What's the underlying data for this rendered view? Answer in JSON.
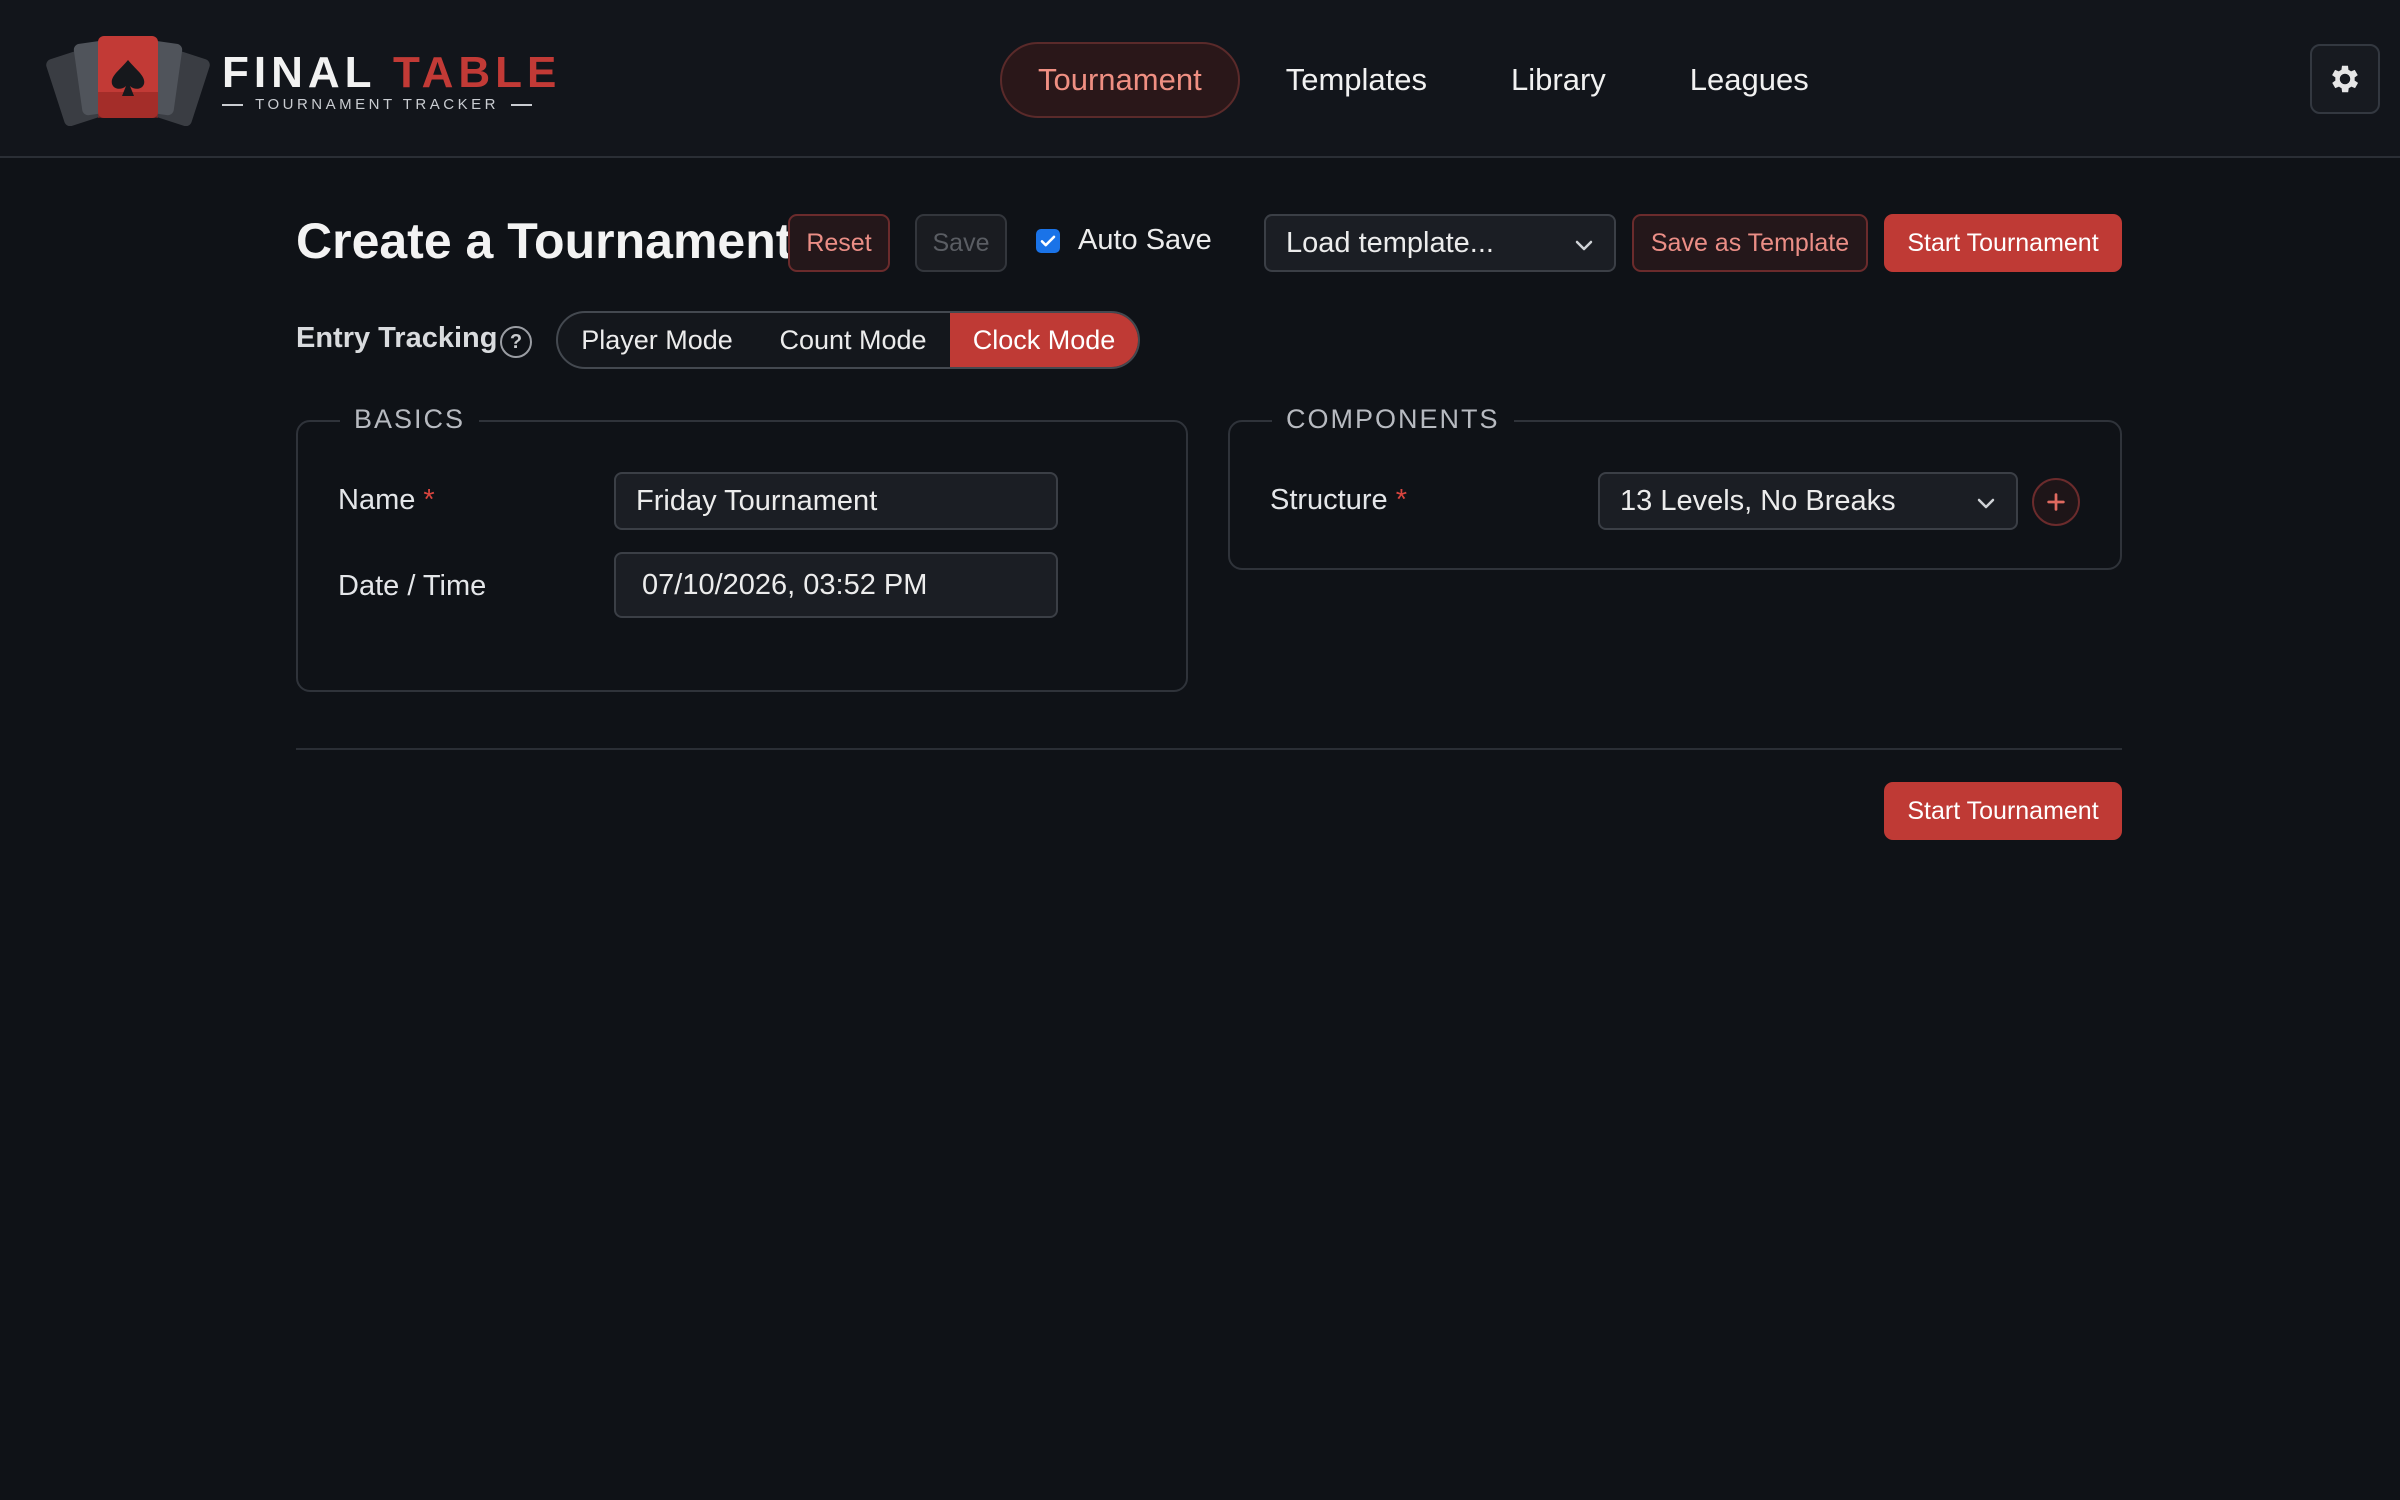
{
  "brand": {
    "title_main": "FINAL",
    "title_accent": "TABLE",
    "subtitle": "TOURNAMENT TRACKER"
  },
  "nav": {
    "items": [
      {
        "label": "Tournament",
        "active": true
      },
      {
        "label": "Templates",
        "active": false
      },
      {
        "label": "Library",
        "active": false
      },
      {
        "label": "Leagues",
        "active": false
      }
    ]
  },
  "toolbar": {
    "title": "Create a Tournament",
    "reset_label": "Reset",
    "save_label": "Save",
    "autosave_label": "Auto Save",
    "autosave_checked": true,
    "load_template_value": "Load template...",
    "save_template_label": "Save as Template",
    "start_label": "Start Tournament"
  },
  "entry_tracking": {
    "label": "Entry Tracking",
    "help": "?",
    "modes": [
      {
        "label": "Player Mode",
        "active": false
      },
      {
        "label": "Count Mode",
        "active": false
      },
      {
        "label": "Clock Mode",
        "active": true
      }
    ]
  },
  "basics": {
    "legend": "BASICS",
    "name_label": "Name",
    "name_value": "Friday Tournament",
    "datetime_label": "Date / Time",
    "datetime_value": "07/10/2026, 03:52 PM",
    "required_mark": "*"
  },
  "components": {
    "legend": "COMPONENTS",
    "structure_label": "Structure",
    "structure_value": "13 Levels, No Breaks",
    "required_mark": "*"
  },
  "footer": {
    "start_label": "Start Tournament"
  },
  "colors": {
    "accent": "#bf3a35",
    "background": "#0f1217",
    "checkbox": "#1a73e8"
  }
}
